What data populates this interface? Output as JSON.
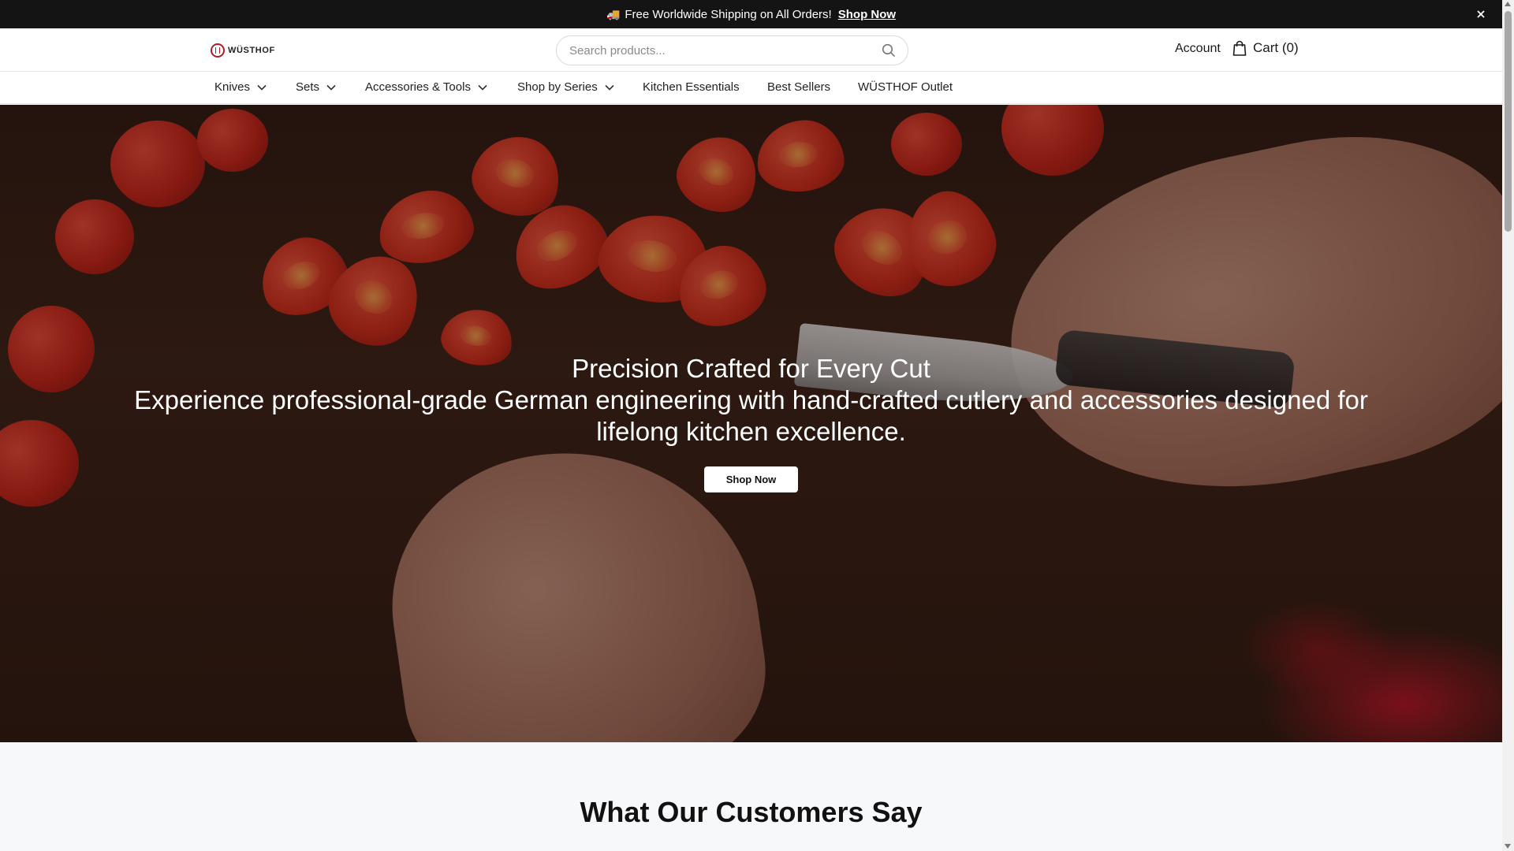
{
  "announcement": {
    "truck_emoji": "🚚",
    "text": "Free Worldwide Shipping on All Orders!",
    "link_label": "Shop Now",
    "close_label": "×"
  },
  "header": {
    "logo_text": "WÜSTHOF",
    "search": {
      "placeholder": "Search products..."
    },
    "account_label": "Account",
    "cart_label": "Cart (0)"
  },
  "nav": {
    "items": [
      {
        "label": "Knives",
        "has_dropdown": true
      },
      {
        "label": "Sets",
        "has_dropdown": true
      },
      {
        "label": "Accessories & Tools",
        "has_dropdown": true
      },
      {
        "label": "Shop by Series",
        "has_dropdown": true
      },
      {
        "label": "Kitchen Essentials",
        "has_dropdown": false
      },
      {
        "label": "Best Sellers",
        "has_dropdown": false
      },
      {
        "label": "WÜSTHOF Outlet",
        "has_dropdown": false
      }
    ]
  },
  "hero": {
    "title": "Precision Crafted for Every Cut",
    "subtitle": "Experience professional-grade German engineering with hand-crafted cutlery and accessories designed for lifelong kitchen excellence.",
    "button_label": "Shop Now"
  },
  "testimonials": {
    "heading": "What Our Customers Say"
  },
  "colors": {
    "brand_red": "#b31b2b",
    "announcement_bg": "#141414",
    "section_bg": "#f7f8fa"
  }
}
